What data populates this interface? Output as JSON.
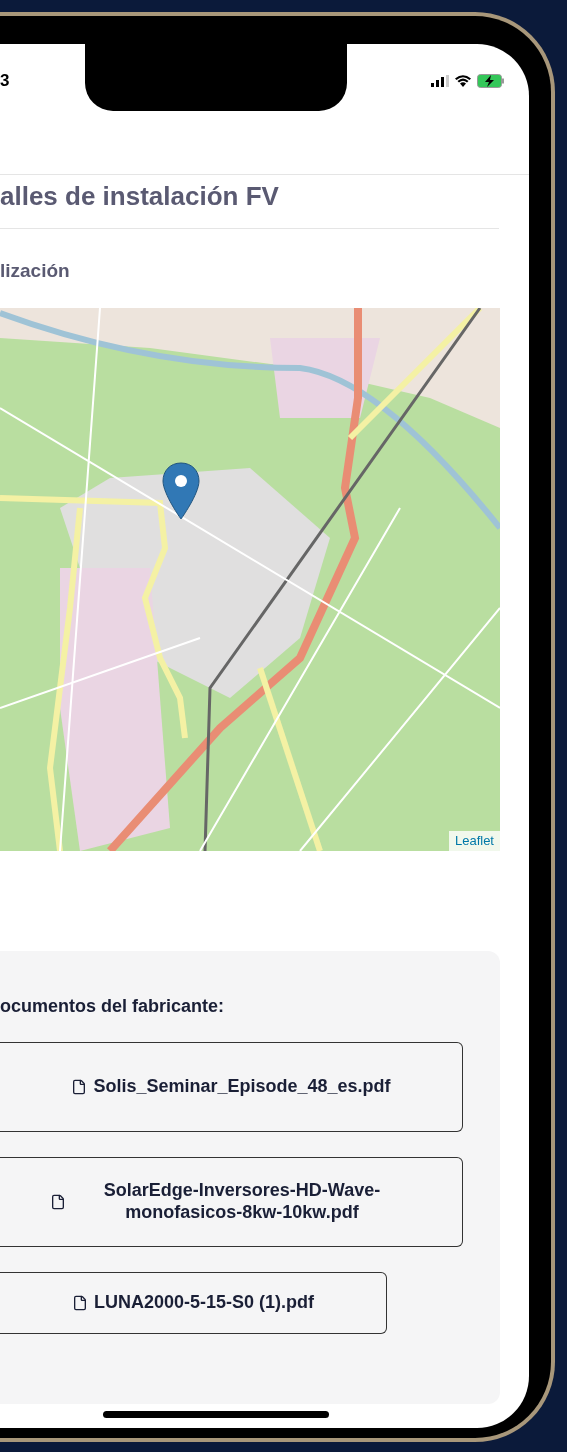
{
  "status_bar": {
    "time": "3"
  },
  "header": {
    "title": "alles de instalación FV"
  },
  "location": {
    "heading": "lización",
    "map": {
      "attribution": "Leaflet"
    }
  },
  "documents": {
    "heading": "ocumentos del fabricante:",
    "files": [
      {
        "name": "Solis_Seminar_Episode_48_es.pdf"
      },
      {
        "name": "SolarEdge-Inversores-HD-Wave-monofasicos-8kw-10kw.pdf"
      },
      {
        "name": "LUNA2000-5-15-S0 (1).pdf"
      }
    ]
  }
}
